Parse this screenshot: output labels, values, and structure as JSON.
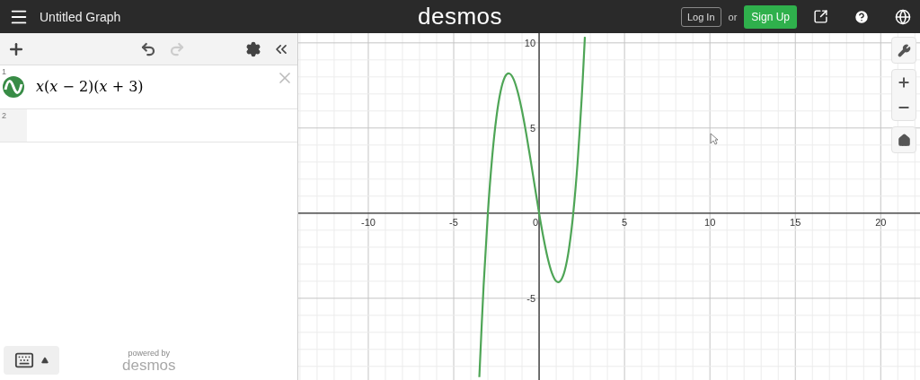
{
  "header": {
    "title": "Untitled Graph",
    "logo": "desmos",
    "login": "Log In",
    "or": "or",
    "signup": "Sign Up"
  },
  "toolbar": {
    "undo": {
      "disabled": false
    },
    "redo": {
      "disabled": true
    }
  },
  "expressions": [
    {
      "number": "1",
      "latex": "*x*(*x* − 2)(*x* + 3)",
      "color": "#388c46"
    },
    {
      "number": "2"
    }
  ],
  "footer": {
    "powered_by": "powered by",
    "brand": "desmos"
  },
  "graph": {
    "chart_data": {
      "type": "line",
      "grid": true,
      "xlim": [
        -14.1,
        22.3
      ],
      "ylim": [
        -9.8,
        10.57
      ],
      "xticks": [
        -10,
        -5,
        0,
        5,
        10,
        15,
        20
      ],
      "yticks": [
        -5,
        5,
        10
      ],
      "x": [
        -3.5,
        -3.25,
        -3,
        -2.75,
        -2.5,
        -2.25,
        -2,
        -1.75,
        -1.5,
        -1.25,
        -1,
        -0.75,
        -0.5,
        -0.25,
        0,
        0.25,
        0.5,
        0.75,
        1,
        1.25,
        1.5,
        1.75,
        2,
        2.25,
        2.5,
        2.68
      ],
      "series": [
        {
          "color": "#4ea556",
          "values": [
            -9.63,
            -4.27,
            0,
            3.27,
            5.63,
            7.17,
            8,
            8.2,
            7.88,
            7.11,
            6,
            4.64,
            3.13,
            1.55,
            0,
            -1.42,
            -2.63,
            -3.52,
            -4,
            -3.98,
            -3.38,
            -2.08,
            0,
            2.95,
            6.88,
            10.35
          ]
        }
      ]
    }
  }
}
